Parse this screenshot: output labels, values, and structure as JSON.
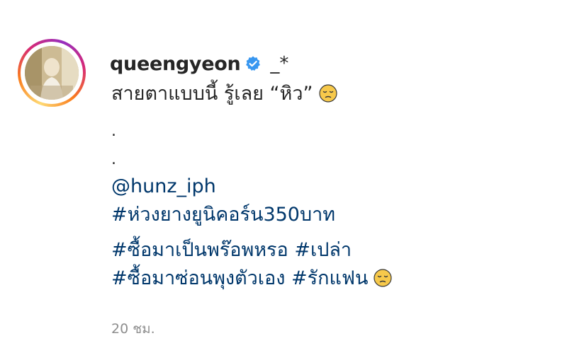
{
  "post": {
    "username": "queengyeon",
    "username_suffix": "_*",
    "caption_line": "สายตาแบบนี้ รู้เลย “หิว”",
    "dot_1": ".",
    "dot_2": ".",
    "mention": "@hunz_iph",
    "hashtags": [
      "#ห่วงยางยูนิคอร์น350บาท",
      "#ซื้อมาเป็นพร๊อพหรอ",
      "#เปล่า",
      "#ซื้อมาซ่อนพุงตัวเอง",
      "#รักแฟน"
    ],
    "timestamp": "20 ชม.",
    "caption_emoji": "pensive-face-icon",
    "verified_badge": "verified-badge-icon"
  },
  "colors": {
    "text": "#262626",
    "link": "#00376b",
    "muted": "#8e8e8e",
    "verified": "#3897f0",
    "emoji_face": "#f7c94b"
  }
}
